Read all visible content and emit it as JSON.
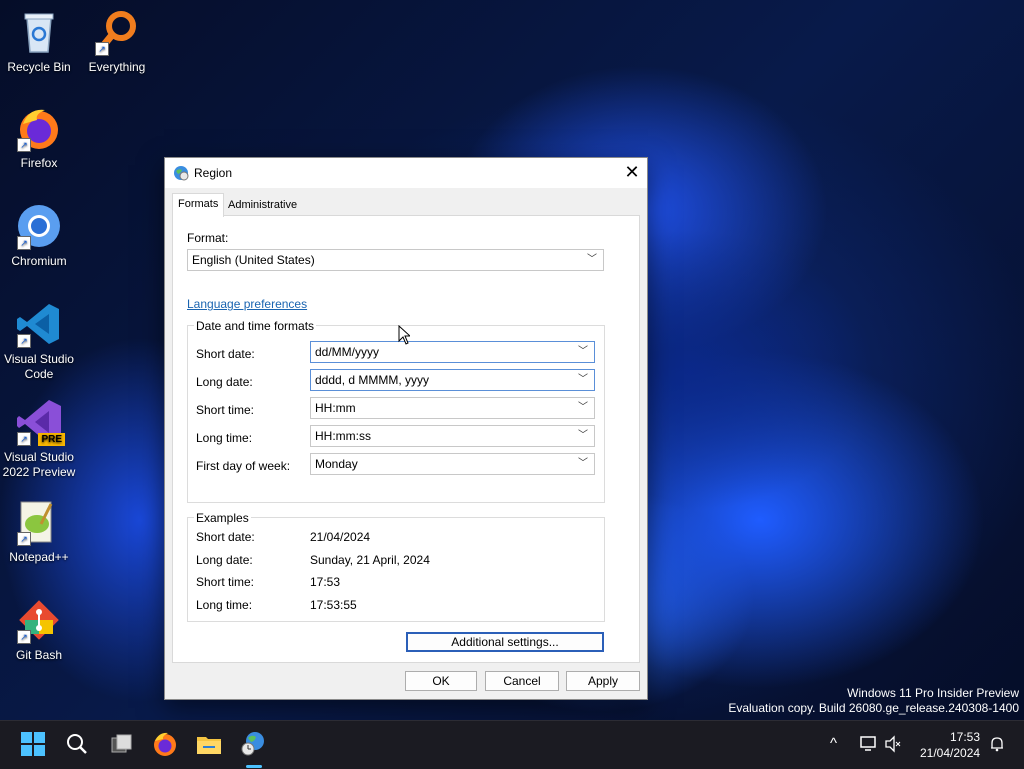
{
  "desktop": {
    "icons": [
      {
        "label": "Recycle Bin",
        "icon": "recycle-bin-icon"
      },
      {
        "label": "Everything",
        "icon": "everything-search-icon"
      },
      {
        "label": "Firefox",
        "icon": "firefox-icon"
      },
      {
        "label": "Chromium",
        "icon": "chromium-icon"
      },
      {
        "label": "Visual Studio Code",
        "icon": "vscode-icon"
      },
      {
        "label": "Visual Studio 2022 Preview",
        "icon": "visual-studio-preview-icon",
        "badge": "PRE"
      },
      {
        "label": "Notepad++",
        "icon": "notepadpp-icon"
      },
      {
        "label": "Git Bash",
        "icon": "git-bash-icon"
      }
    ],
    "watermark": {
      "line1": "Windows 11 Pro Insider Preview",
      "line2": "Evaluation copy. Build 26080.ge_release.240308-1400"
    }
  },
  "dialog": {
    "title": "Region",
    "close_glyph": "✕",
    "tabs": [
      {
        "label": "Formats",
        "active": true
      },
      {
        "label": "Administrative",
        "active": false
      }
    ],
    "format_label": "Format:",
    "format_value": "English (United States)",
    "language_link": "Language preferences",
    "date_time_group": "Date and time formats",
    "fields": [
      {
        "label": "Short date:",
        "value": "dd/MM/yyyy"
      },
      {
        "label": "Long date:",
        "value": "dddd, d MMMM, yyyy"
      },
      {
        "label": "Short time:",
        "value": "HH:mm"
      },
      {
        "label": "Long time:",
        "value": "HH:mm:ss"
      },
      {
        "label": "First day of week:",
        "value": "Monday"
      }
    ],
    "examples_group": "Examples",
    "examples": [
      {
        "label": "Short date:",
        "value": "21/04/2024"
      },
      {
        "label": "Long date:",
        "value": "Sunday, 21 April, 2024"
      },
      {
        "label": "Short time:",
        "value": "17:53"
      },
      {
        "label": "Long time:",
        "value": "17:53:55"
      }
    ],
    "additional_settings": "Additional settings...",
    "ok": "OK",
    "cancel": "Cancel",
    "apply": "Apply"
  },
  "taskbar": {
    "items": [
      "start-icon",
      "search-icon",
      "task-view-icon",
      "firefox-icon",
      "file-explorer-icon",
      "region-control-panel-icon"
    ],
    "tray": {
      "chevron": "^",
      "time": "17:53",
      "date": "21/04/2024"
    }
  },
  "colors": {
    "accent": "#2b5fb8",
    "link": "#1a64b0",
    "taskbar": "#1b1b22"
  }
}
